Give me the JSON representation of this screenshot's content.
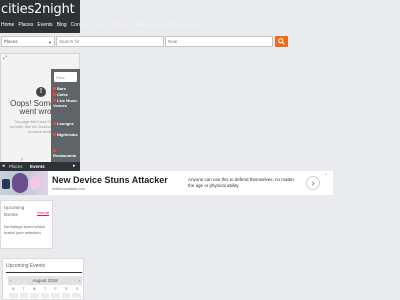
{
  "header": {
    "logo": "cities2night",
    "nav": [
      "Home",
      "Places",
      "Events",
      "Blog",
      "Contact",
      "News",
      "Add Place",
      "Add Event",
      "Add Blog Entries"
    ]
  },
  "search": {
    "category_value": "Places",
    "keyword_placeholder": "Search for",
    "location_placeholder": "Near"
  },
  "widget": {
    "error_title": "Oops! Something went wrong.",
    "error_message": "This page didn't load Google Maps correctly. See the JavaScript console for technical details.",
    "filter_placeholder": "Filter",
    "categories": [
      "Bars",
      "Cafes",
      "Live Music Venues",
      "Lounges",
      "Nightclubs",
      "Restaurants"
    ],
    "tabs": [
      "Places",
      "Events"
    ]
  },
  "ad": {
    "title": "New Device Stuns Attacker",
    "source": "bellefenceattack.com",
    "description": "Anyone can use this to defend themselves, no matter the age or physical ability.",
    "next_icon": "chevron-right"
  },
  "upcoming_small": {
    "title": "Upcoming Events",
    "view_all": "View all",
    "empty_message": "No listings found which match your selection"
  },
  "upcoming_calendar": {
    "title": "Upcoming Events",
    "month": "August 2018",
    "days": [
      "M",
      "T",
      "W",
      "T",
      "F",
      "S",
      "S"
    ]
  },
  "colors": {
    "accent": "#ef6c1a",
    "header_dark": "#2e3136",
    "link_red": "#e14"
  }
}
